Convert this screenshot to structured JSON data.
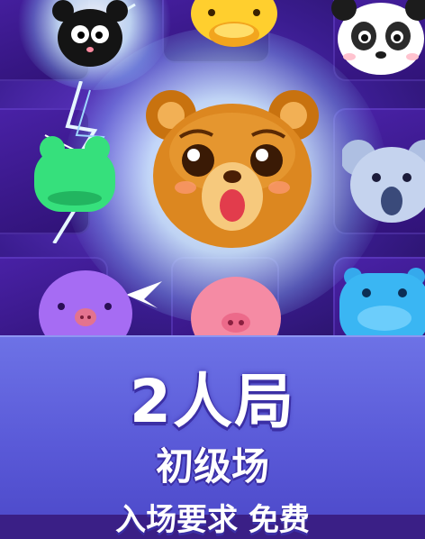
{
  "board": {
    "tiles": [
      {
        "animal": "black-cat",
        "color": "#1a1a1a"
      },
      {
        "animal": "yellow-duck",
        "color": "#ffc928"
      },
      {
        "animal": "panda",
        "color": "#ffffff"
      },
      {
        "animal": "green-frog",
        "color": "#3fe07a"
      },
      {
        "animal": "brown-bear",
        "color": "#d98a1f"
      },
      {
        "animal": "grey-koala",
        "color": "#b9c8e6"
      },
      {
        "animal": "purple-pig",
        "color": "#a46cf2"
      },
      {
        "animal": "pink-pig",
        "color": "#f58ba4"
      },
      {
        "animal": "blue-hippo",
        "color": "#3fb8f5"
      }
    ]
  },
  "banner": {
    "title": "2人局",
    "subtitle": "初级场",
    "requirement": "入场要求 免费"
  },
  "colors": {
    "banner": "#5e62dc",
    "board": "#3a1c8f",
    "text_outline": "#3b2fa5"
  }
}
